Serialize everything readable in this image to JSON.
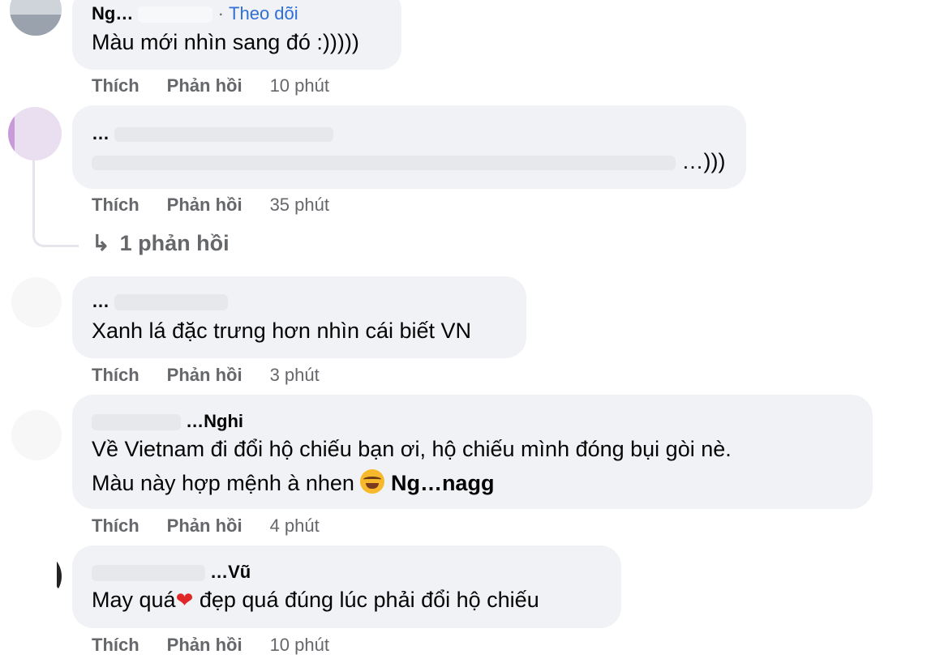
{
  "comments": [
    {
      "author": "Ng…",
      "separator": "·",
      "follow": "Theo dõi",
      "text": "Màu mới nhìn sang đó :)))))",
      "like": "Thích",
      "reply": "Phản hồi",
      "time": "10 phút"
    },
    {
      "author": "…",
      "text": "…)))",
      "like": "Thích",
      "reply": "Phản hồi",
      "time": "35 phút",
      "replies_label": "1 phản hồi"
    },
    {
      "author": "…",
      "text": "Xanh lá đặc trưng hơn nhìn cái biết VN",
      "like": "Thích",
      "reply": "Phản hồi",
      "time": "3 phút"
    },
    {
      "author": "…Nghi",
      "text_line1": "Về Vietnam đi đổi hộ chiếu bạn ơi, hộ chiếu mình đóng bụi gòi nè.",
      "text_line2": "Màu này hợp mệnh à nhen",
      "emoji": "rolling-on-floor-laughing",
      "mention": "Ng…nagg",
      "like": "Thích",
      "reply": "Phản hồi",
      "time": "4 phút"
    },
    {
      "author": "…Vũ",
      "text_before": "May quá",
      "heart": "❤",
      "text_after": " đẹp quá đúng lúc phải đổi hộ chiếu",
      "like": "Thích",
      "reply": "Phản hồi",
      "time": "10 phút"
    }
  ],
  "icons": {
    "reply_arrow": "↳"
  },
  "colors": {
    "bubble": "#f0f2f5",
    "link": "#2f6fd6",
    "meta": "#65676b"
  }
}
